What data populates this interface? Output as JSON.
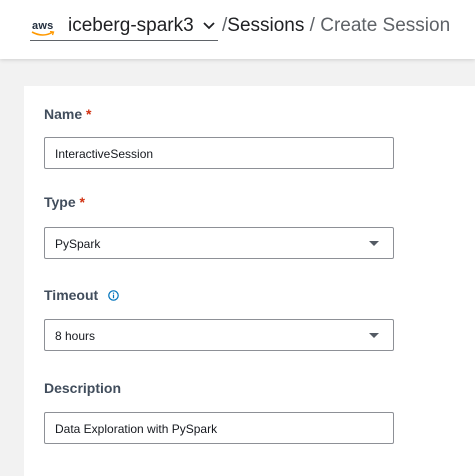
{
  "header": {
    "logo_text": "aws",
    "project_name": "iceberg-spark3",
    "breadcrumb": {
      "separator": "/",
      "sessions": "Sessions",
      "current": "Create Session"
    }
  },
  "form": {
    "name": {
      "label": "Name",
      "required_mark": "*",
      "value": "InteractiveSession"
    },
    "type": {
      "label": "Type",
      "required_mark": "*",
      "value": "PySpark"
    },
    "timeout": {
      "label": "Timeout",
      "value": "8 hours"
    },
    "description": {
      "label": "Description",
      "value": "Data Exploration with PySpark"
    }
  },
  "colors": {
    "required": "#d13212",
    "info_icon": "#0073bb",
    "label": "#414d5c"
  }
}
